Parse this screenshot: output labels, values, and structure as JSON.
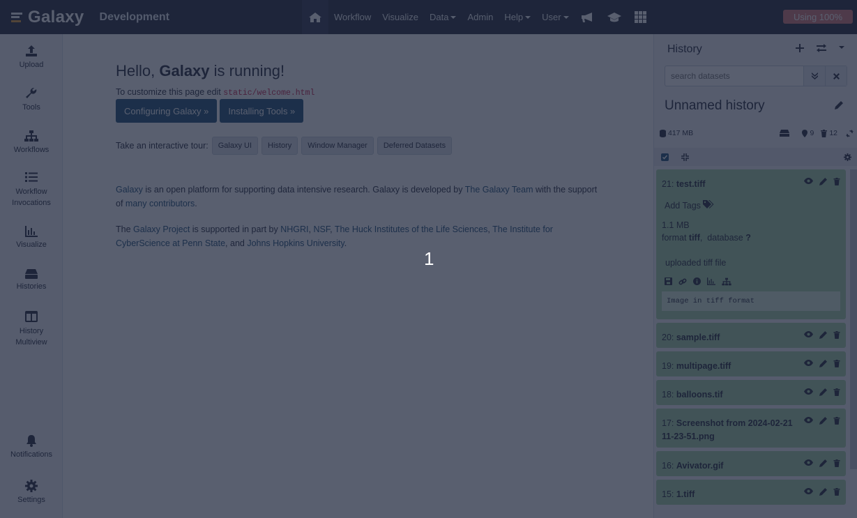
{
  "masthead": {
    "brand": "Galaxy",
    "brand_sub": "Development",
    "nav": [
      {
        "label": "Workflow",
        "dropdown": false
      },
      {
        "label": "Visualize",
        "dropdown": false
      },
      {
        "label": "Data",
        "dropdown": true
      },
      {
        "label": "Admin",
        "dropdown": false
      },
      {
        "label": "Help",
        "dropdown": true
      },
      {
        "label": "User",
        "dropdown": true
      }
    ],
    "quota": "Using 100%"
  },
  "activity_bar": {
    "items": [
      {
        "label": "Upload",
        "icon": "upload-icon"
      },
      {
        "label": "Tools",
        "icon": "wrench-icon"
      },
      {
        "label": "Workflows",
        "icon": "sitemap-icon"
      },
      {
        "label": "Workflow Invocations",
        "icon": "list-icon"
      },
      {
        "label": "Visualize",
        "icon": "chart-bar-icon"
      },
      {
        "label": "Histories",
        "icon": "hdd-icon"
      },
      {
        "label": "History Multiview",
        "icon": "columns-icon"
      },
      {
        "label": "Notifications",
        "icon": "bell-icon"
      },
      {
        "label": "Settings",
        "icon": "gear-icon"
      }
    ]
  },
  "welcome": {
    "title_pre": "Hello, ",
    "title_bold": "Galaxy",
    "title_post": " is running!",
    "customize_text": "To customize this page edit ",
    "customize_code": "static/welcome.html",
    "btn_config": "Configuring Galaxy »",
    "btn_tools": "Installing Tools »",
    "tour_label": "Take an interactive tour:",
    "tours": [
      "Galaxy UI",
      "History",
      "Window Manager",
      "Deferred Datasets"
    ],
    "para1": {
      "a": "Galaxy",
      "b": " is an open platform for supporting data intensive research. Galaxy is developed by ",
      "c": "The Galaxy Team",
      "d": " with the support of ",
      "e": "many contributors",
      "f": "."
    },
    "para2": {
      "a": "The ",
      "b": "Galaxy Project",
      "c": " is supported in part by ",
      "d": "NHGRI",
      "e": ", ",
      "f": "NSF",
      "g": ", ",
      "h": "The Huck Institutes of the Life Sciences",
      "i": ", ",
      "j": "The Institute for CyberScience at Penn State",
      "k": ", and ",
      "l": "Johns Hopkins University",
      "m": "."
    },
    "marker": "1"
  },
  "history": {
    "title": "History",
    "search_placeholder": "search datasets",
    "name": "Unnamed history",
    "size": "417 MB",
    "shown_count": "9",
    "deleted_count": "12",
    "expanded": {
      "hid": "21",
      "name": "test.tiff",
      "add_tags": "Add Tags",
      "size": "1.1 MB",
      "format_label": "format ",
      "format": "tiff",
      "db_label": ",  database ",
      "db": "?",
      "info": "uploaded tiff file",
      "peek": "Image in tiff format"
    },
    "datasets": [
      {
        "hid": "20",
        "name": "sample.tiff"
      },
      {
        "hid": "19",
        "name": "multipage.tiff"
      },
      {
        "hid": "18",
        "name": "balloons.tif"
      },
      {
        "hid": "17",
        "name": "Screenshot from 2024-02-21 11-23-51.png"
      },
      {
        "hid": "16",
        "name": "Avivator.gif"
      },
      {
        "hid": "15",
        "name": "1.tiff"
      }
    ],
    "colors": {
      "ok": "#a9d5a9",
      "brand": "#2c3143",
      "quota": "#d67c7c"
    }
  }
}
